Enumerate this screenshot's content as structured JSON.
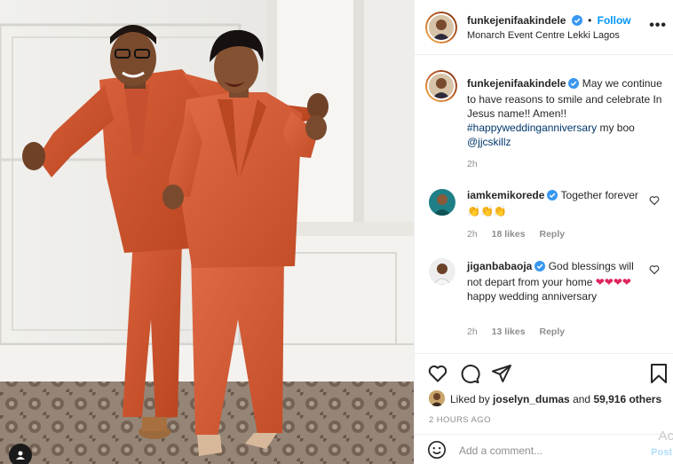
{
  "post": {
    "username": "funkejenifaakindele",
    "follow_label": "Follow",
    "separator": "•",
    "location": "Monarch Event Centre Lekki Lagos",
    "more_label": "•••"
  },
  "caption": {
    "username": "funkejenifaakindele",
    "text_1": "May we continue to have reasons to smile and celebrate In Jesus name!! Amen!!",
    "hashtag": "#happyweddinganniversary",
    "text_2": " my boo ",
    "mention": "@jjcskillz",
    "time": "2h"
  },
  "comments": [
    {
      "username": "iamkemikorede",
      "text": "Together forever",
      "emojis": "👏👏👏",
      "time": "2h",
      "likes": "18 likes",
      "reply": "Reply"
    },
    {
      "username": "jiganbabaoja",
      "text_1": "God blessings will not depart from your home",
      "emojis": "❤❤❤❤",
      "text_2": "happy wedding anniversary",
      "time": "2h",
      "likes": "13 likes",
      "reply": "Reply"
    }
  ],
  "likes": {
    "prefix": "Liked by ",
    "user": "joselyn_dumas",
    "middle": " and ",
    "count": "59,916 others"
  },
  "post_age": "2 HOURS AGO",
  "comment_box": {
    "placeholder": "Add a comment...",
    "post_label": "Post"
  },
  "watermark": "Ac",
  "colors": {
    "accent_blue": "#0095f6",
    "link_blue": "#00376b",
    "suit_orange": "#d2542e",
    "muted": "#8e8e8e"
  },
  "icons": {
    "heart": "heart-icon",
    "comment": "comment-icon",
    "share": "share-icon",
    "save": "bookmark-icon",
    "verified": "verified-badge-icon",
    "more": "more-options-icon",
    "emoji": "emoji-icon",
    "user_tag": "user-tag-icon"
  }
}
